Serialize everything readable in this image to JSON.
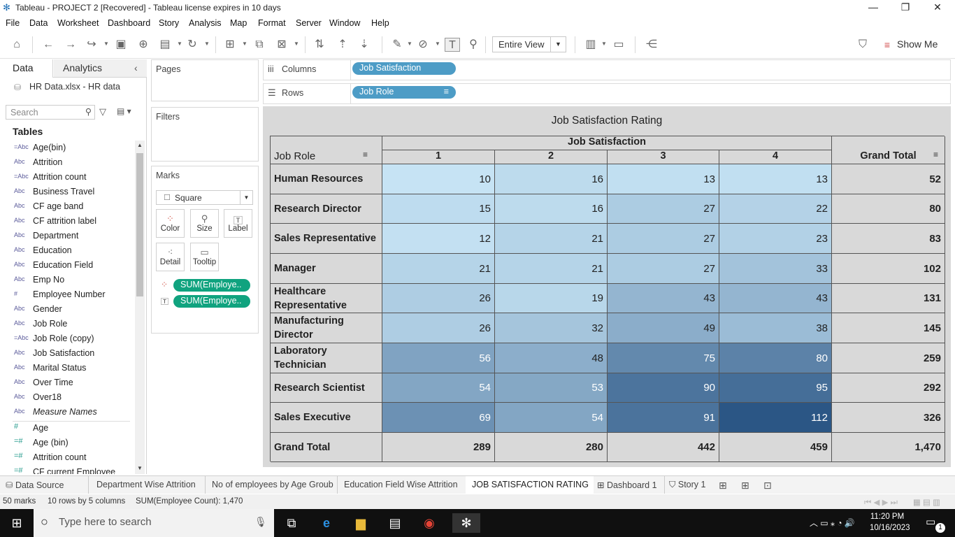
{
  "window": {
    "title": "Tableau - PROJECT 2 [Recovered] - Tableau license expires in 10 days"
  },
  "menu": [
    "File",
    "Data",
    "Worksheet",
    "Dashboard",
    "Story",
    "Analysis",
    "Map",
    "Format",
    "Server",
    "Window",
    "Help"
  ],
  "toolbar": {
    "fit": "Entire View",
    "show_me": "Show Me"
  },
  "datapane": {
    "tab_data": "Data",
    "tab_analytics": "Analytics",
    "datasource": "HR Data.xlsx - HR data",
    "search_placeholder": "Search",
    "tables_label": "Tables",
    "dimensions": [
      {
        "icon": "=Abc",
        "name": "Age(bin)"
      },
      {
        "icon": "Abc",
        "name": "Attrition"
      },
      {
        "icon": "=Abc",
        "name": "Attrition count"
      },
      {
        "icon": "Abc",
        "name": "Business Travel"
      },
      {
        "icon": "Abc",
        "name": "CF age band"
      },
      {
        "icon": "Abc",
        "name": "CF attrition label"
      },
      {
        "icon": "Abc",
        "name": "Department"
      },
      {
        "icon": "Abc",
        "name": "Education"
      },
      {
        "icon": "Abc",
        "name": "Education Field"
      },
      {
        "icon": "Abc",
        "name": "Emp No"
      },
      {
        "icon": "#",
        "name": "Employee Number"
      },
      {
        "icon": "Abc",
        "name": "Gender"
      },
      {
        "icon": "Abc",
        "name": "Job Role"
      },
      {
        "icon": "=Abc",
        "name": "Job Role (copy)"
      },
      {
        "icon": "Abc",
        "name": "Job Satisfaction"
      },
      {
        "icon": "Abc",
        "name": "Marital Status"
      },
      {
        "icon": "Abc",
        "name": "Over Time"
      },
      {
        "icon": "Abc",
        "name": "Over18"
      },
      {
        "icon": "Abc",
        "name": "Measure Names"
      }
    ],
    "measures": [
      {
        "icon": "#",
        "name": "Age"
      },
      {
        "icon": "=#",
        "name": "Age (bin)"
      },
      {
        "icon": "=#",
        "name": "Attrition count"
      },
      {
        "icon": "=#",
        "name": "CF current Employee"
      }
    ]
  },
  "cards": {
    "pages": "Pages",
    "filters": "Filters",
    "marks": "Marks",
    "mark_type": "Square",
    "buttons": [
      "Color",
      "Size",
      "Label",
      "Detail",
      "Tooltip"
    ],
    "pills": [
      "SUM(Employe..",
      "SUM(Employe.."
    ]
  },
  "shelves": {
    "columns_label": "Columns",
    "columns_pill": "Job Satisfaction",
    "rows_label": "Rows",
    "rows_pill": "Job Role"
  },
  "viz": {
    "title": "Job Satisfaction Rating",
    "row_header": "Job Role",
    "col_group": "Job Satisfaction",
    "col_headers": [
      "1",
      "2",
      "3",
      "4",
      "Grand Total"
    ],
    "rows": [
      {
        "label": "Human Resources",
        "values": [
          "10",
          "16",
          "13",
          "13"
        ],
        "total": "52"
      },
      {
        "label": "Research Director",
        "values": [
          "15",
          "16",
          "27",
          "22"
        ],
        "total": "80"
      },
      {
        "label": "Sales Representative",
        "values": [
          "12",
          "21",
          "27",
          "23"
        ],
        "total": "83"
      },
      {
        "label": "Manager",
        "values": [
          "21",
          "21",
          "27",
          "33"
        ],
        "total": "102"
      },
      {
        "label": "Healthcare Representative",
        "values": [
          "26",
          "19",
          "43",
          "43"
        ],
        "total": "131"
      },
      {
        "label": "Manufacturing Director",
        "values": [
          "26",
          "32",
          "49",
          "38"
        ],
        "total": "145"
      },
      {
        "label": "Laboratory Technician",
        "values": [
          "56",
          "48",
          "75",
          "80"
        ],
        "total": "259"
      },
      {
        "label": "Research Scientist",
        "values": [
          "54",
          "53",
          "90",
          "95"
        ],
        "total": "292"
      },
      {
        "label": "Sales Executive",
        "values": [
          "69",
          "54",
          "91",
          "112"
        ],
        "total": "326"
      }
    ],
    "grand_total": {
      "label": "Grand Total",
      "values": [
        "289",
        "280",
        "442",
        "459"
      ],
      "total": "1,470"
    },
    "color_low": "#c6e3f4",
    "color_high": "#2b5685"
  },
  "sheet_tabs": [
    "Data Source",
    "Department Wise Attrition",
    "No of employees by Age Groub",
    "Education Field Wise Attrition",
    "JOB SATISFACTION RATING",
    "Dashboard 1",
    "Story 1"
  ],
  "status": {
    "marks": "50 marks",
    "dims": "10 rows by 5 columns",
    "sum": "SUM(Employee Count): 1,470"
  },
  "taskbar": {
    "search": "Type here to search",
    "time": "11:20 PM",
    "date": "10/16/2023",
    "notif": "1"
  }
}
